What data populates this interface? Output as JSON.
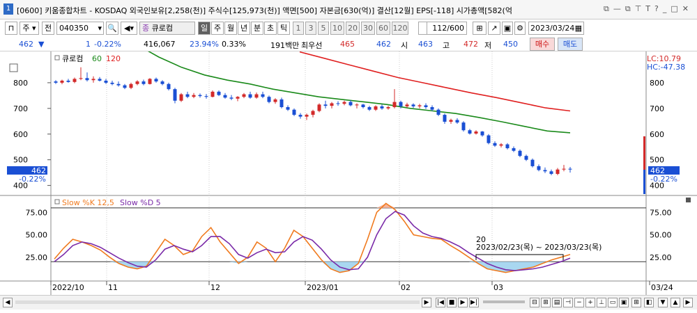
{
  "titlebar": {
    "num": "1",
    "title": "[0600] 키움종합차트 - KOSDAQ 외국인보유[2,258(천)] 주식수[125,973(천)] 액면[500] 자본금[630(억)] 결산[12월] EPS[-118] 시가총액[582(억"
  },
  "toolbar": {
    "type": "주",
    "code_label": "전",
    "code": "040350",
    "name": "큐로컴",
    "periods": [
      "일",
      "주",
      "월",
      "년",
      "분",
      "초",
      "틱"
    ],
    "minutes": [
      "1",
      "3",
      "5",
      "10",
      "20",
      "30",
      "60",
      "120"
    ],
    "count": "112",
    "count_total": "/600",
    "date": "2023/03/24"
  },
  "quote": {
    "price": "462",
    "change": "1",
    "change_pct": "-0.22%",
    "volume": "416,067",
    "turnover": "23.94%",
    "ratio": "0.33%",
    "amount": "191백만",
    "best_label": "최우선",
    "best_ask": "465",
    "best_bid": "462",
    "open_label": "시",
    "open": "463",
    "high_label": "고",
    "high": "472",
    "low_label": "저",
    "low": "450",
    "buy_label": "매수",
    "sell_label": "매도"
  },
  "price_panel": {
    "legend_name": "큐로컴",
    "ma1": "60",
    "ma2": "120",
    "lc": "LC:10.79",
    "hc": "HC:-47.38",
    "cur_price": "462",
    "cur_pct": "-0.22%"
  },
  "stoch_panel": {
    "legend_k": "Slow %K 12,5",
    "legend_d": "Slow %D 5",
    "annot_n": "20",
    "annot_range": "2023/02/23(목) ~ 2023/03/23(목)"
  },
  "x_labels": [
    "2022/10",
    "11",
    "12",
    "2023/01",
    "02",
    "03",
    "03/24"
  ],
  "colors": {
    "up": "#d32a2a",
    "down": "#1a4fd4",
    "ma60": "#1a8a1a",
    "ma120": "#e02020",
    "slowk": "#f07a1e",
    "slowd": "#7a2aa8",
    "oversold_fill": "#a9d7f0",
    "overbought_fill": "#f6b59a"
  },
  "chart_data": [
    {
      "type": "candlestick",
      "title": "",
      "yticks": [
        400,
        500,
        600,
        700,
        800
      ],
      "ylim": [
        380,
        900
      ],
      "series": [
        {
          "name": "큐로컴",
          "values": [
            [
              805,
              810,
              795,
              800
            ],
            [
              800,
              812,
              794,
              808
            ],
            [
              808,
              815,
              800,
              803
            ],
            [
              803,
              820,
              798,
              815
            ],
            [
              815,
              860,
              810,
              818
            ],
            [
              818,
              840,
              805,
              810
            ],
            [
              810,
              825,
              800,
              815
            ],
            [
              815,
              822,
              805,
              808
            ],
            [
              808,
              815,
              795,
              800
            ],
            [
              800,
              808,
              790,
              795
            ],
            [
              795,
              805,
              785,
              790
            ],
            [
              790,
              795,
              775,
              780
            ],
            [
              780,
              800,
              775,
              795
            ],
            [
              795,
              810,
              790,
              805
            ],
            [
              805,
              812,
              790,
              795
            ],
            [
              795,
              818,
              793,
              815
            ],
            [
              815,
              820,
              800,
              805
            ],
            [
              805,
              810,
              790,
              795
            ],
            [
              795,
              800,
              770,
              775
            ],
            [
              775,
              780,
              720,
              730
            ],
            [
              730,
              760,
              725,
              755
            ],
            [
              755,
              765,
              740,
              745
            ],
            [
              745,
              760,
              740,
              752
            ],
            [
              752,
              758,
              742,
              748
            ],
            [
              748,
              756,
              738,
              745
            ],
            [
              745,
              770,
              743,
              765
            ],
            [
              765,
              770,
              748,
              752
            ],
            [
              752,
              760,
              738,
              742
            ],
            [
              742,
              752,
              732,
              738
            ],
            [
              738,
              748,
              728,
              745
            ],
            [
              745,
              760,
              740,
              755
            ],
            [
              755,
              765,
              738,
              742
            ],
            [
              742,
              762,
              738,
              755
            ],
            [
              755,
              765,
              740,
              745
            ],
            [
              745,
              750,
              720,
              725
            ],
            [
              725,
              740,
              718,
              735
            ],
            [
              735,
              742,
              700,
              705
            ],
            [
              705,
              712,
              690,
              695
            ],
            [
              695,
              700,
              670,
              675
            ],
            [
              675,
              682,
              660,
              668
            ],
            [
              668,
              680,
              655,
              675
            ],
            [
              675,
              695,
              665,
              690
            ],
            [
              690,
              720,
              685,
              715
            ],
            [
              715,
              730,
              700,
              710
            ],
            [
              710,
              725,
              700,
              720
            ],
            [
              720,
              728,
              710,
              718
            ],
            [
              718,
              730,
              712,
              725
            ],
            [
              725,
              732,
              708,
              712
            ],
            [
              712,
              720,
              700,
              715
            ],
            [
              715,
              718,
              700,
              705
            ],
            [
              705,
              710,
              690,
              695
            ],
            [
              695,
              712,
              690,
              708
            ],
            [
              708,
              715,
              695,
              700
            ],
            [
              700,
              710,
              695,
              705
            ],
            [
              705,
              775,
              700,
              725
            ],
            [
              725,
              730,
              700,
              708
            ],
            [
              708,
              722,
              702,
              715
            ],
            [
              715,
              720,
              702,
              708
            ],
            [
              708,
              718,
              700,
              712
            ],
            [
              712,
              720,
              698,
              705
            ],
            [
              705,
              712,
              690,
              695
            ],
            [
              695,
              700,
              670,
              675
            ],
            [
              675,
              680,
              640,
              648
            ],
            [
              648,
              660,
              640,
              655
            ],
            [
              655,
              662,
              640,
              645
            ],
            [
              645,
              650,
              610,
              615
            ],
            [
              615,
              620,
              598,
              602
            ],
            [
              602,
              615,
              598,
              610
            ],
            [
              610,
              612,
              590,
              595
            ],
            [
              595,
              600,
              560,
              565
            ],
            [
              565,
              572,
              550,
              555
            ],
            [
              555,
              565,
              548,
              560
            ],
            [
              560,
              565,
              540,
              545
            ],
            [
              545,
              552,
              530,
              535
            ],
            [
              535,
              540,
              510,
              515
            ],
            [
              515,
              520,
              495,
              500
            ],
            [
              500,
              505,
              470,
              475
            ],
            [
              475,
              482,
              455,
              460
            ],
            [
              460,
              470,
              448,
              455
            ],
            [
              455,
              462,
              440,
              445
            ],
            [
              445,
              468,
              440,
              462
            ],
            [
              462,
              480,
              455,
              465
            ],
            [
              465,
              472,
              450,
              462
            ]
          ]
        },
        {
          "name": "60",
          "values": [
            950,
            900,
            860,
            830,
            810,
            795,
            775,
            760,
            745,
            735,
            725,
            715,
            700,
            690,
            680,
            665,
            648,
            630,
            612,
            605
          ]
        },
        {
          "name": "120",
          "values": [
            920,
            895,
            870,
            845,
            820,
            800,
            780,
            760,
            742,
            722,
            702,
            690
          ]
        }
      ]
    },
    {
      "type": "line",
      "title": "",
      "yticks": [
        25,
        50,
        75
      ],
      "ylim": [
        0,
        90
      ],
      "series": [
        {
          "name": "Slow %K 12,5",
          "values": [
            23,
            35,
            45,
            42,
            38,
            33,
            25,
            18,
            14,
            12,
            15,
            30,
            45,
            38,
            28,
            32,
            48,
            58,
            42,
            30,
            18,
            25,
            42,
            35,
            20,
            35,
            55,
            48,
            35,
            22,
            12,
            8,
            10,
            18,
            45,
            75,
            85,
            78,
            65,
            50,
            48,
            46,
            45,
            38,
            32,
            25,
            18,
            12,
            10,
            8,
            10,
            12,
            14,
            18,
            22,
            25,
            28
          ]
        },
        {
          "name": "Slow %D 5",
          "values": [
            20,
            28,
            38,
            42,
            40,
            36,
            30,
            24,
            19,
            15,
            14,
            22,
            34,
            38,
            34,
            31,
            38,
            48,
            48,
            40,
            28,
            24,
            30,
            34,
            30,
            31,
            42,
            48,
            44,
            34,
            22,
            14,
            11,
            12,
            25,
            50,
            68,
            76,
            72,
            60,
            52,
            48,
            46,
            42,
            37,
            30,
            24,
            18,
            14,
            11,
            10,
            11,
            12,
            14,
            17,
            20,
            24
          ]
        }
      ]
    }
  ]
}
